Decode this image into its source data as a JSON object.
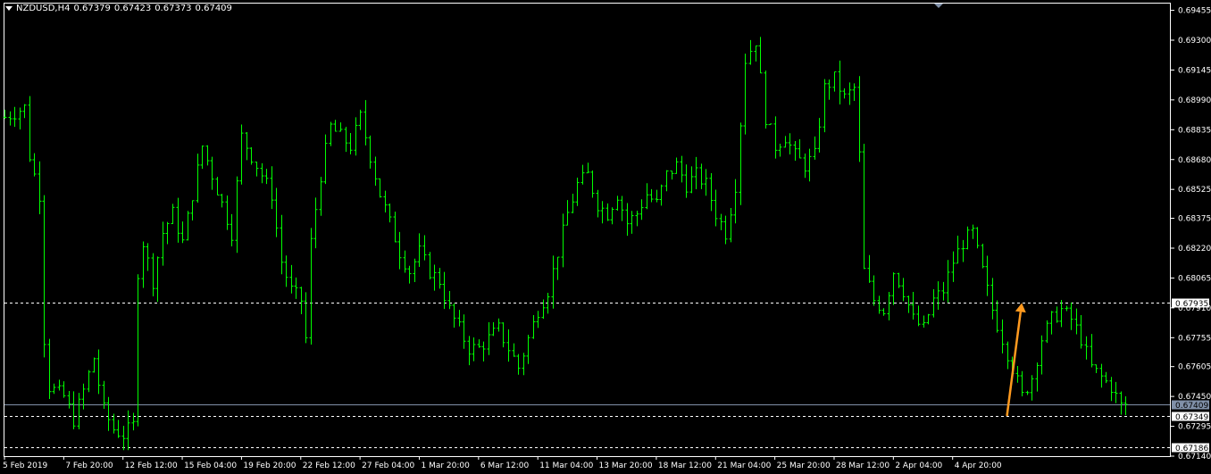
{
  "header": {
    "symbol": "NZDUSD,H4",
    "open": "0.67379",
    "high": "0.67423",
    "low": "0.67373",
    "close": "0.67409"
  },
  "colors": {
    "background": "#000000",
    "candle": "#00ff00",
    "axis": "#ffffff",
    "grid_dashed": "#ffffff",
    "bid_line": "#8090a8",
    "arrow": "#ff9a1f"
  },
  "chart_data": {
    "type": "line",
    "title": "NZDUSD,H4",
    "price_axis_labels": [
      "0.69455",
      "0.69300",
      "0.69145",
      "0.68990",
      "0.68835",
      "0.68680",
      "0.68525",
      "0.68375",
      "0.68220",
      "0.68065",
      "0.67910",
      "0.67755",
      "0.67605",
      "0.67450",
      "0.67295",
      "0.67140"
    ],
    "time_axis_labels": [
      "5 Feb 2019",
      "7 Feb 20:00",
      "12 Feb 12:00",
      "15 Feb 04:00",
      "19 Feb 20:00",
      "22 Feb 12:00",
      "27 Feb 04:00",
      "1 Mar 20:00",
      "6 Mar 12:00",
      "11 Mar 04:00",
      "13 Mar 20:00",
      "18 Mar 12:00",
      "21 Mar 04:00",
      "25 Mar 20:00",
      "28 Mar 12:00",
      "2 Apr 04:00",
      "4 Apr 20:00"
    ],
    "ylim": [
      0.6714,
      0.6949
    ],
    "x_range_bars": [
      0,
      236
    ],
    "x_ticks_bars": [
      0,
      12,
      24,
      36,
      48,
      60,
      72,
      84,
      96,
      108,
      120,
      132,
      144,
      156,
      168,
      180,
      192
    ],
    "horizontal_lines": [
      {
        "price": 0.67935,
        "label": "0.67935",
        "style": "dashed"
      },
      {
        "price": 0.67409,
        "label": "0.67409",
        "style": "solid"
      },
      {
        "price": 0.67349,
        "label": "0.67349",
        "style": "dashed"
      },
      {
        "price": 0.67186,
        "label": "0.67186",
        "style": "dashed"
      }
    ],
    "arrow": {
      "from": {
        "bar": 203,
        "price": 0.67349
      },
      "to": {
        "bar": 206,
        "price": 0.67935
      }
    },
    "series": [
      {
        "price_path": [
          {
            "bar": 0,
            "price": 0.689
          },
          {
            "bar": 4,
            "price": 0.6895
          },
          {
            "bar": 5,
            "price": 0.687
          },
          {
            "bar": 7,
            "price": 0.685
          },
          {
            "bar": 8,
            "price": 0.6775
          },
          {
            "bar": 9,
            "price": 0.675
          },
          {
            "bar": 12,
            "price": 0.6745
          },
          {
            "bar": 14,
            "price": 0.6733
          },
          {
            "bar": 16,
            "price": 0.6748
          },
          {
            "bar": 18,
            "price": 0.6765
          },
          {
            "bar": 20,
            "price": 0.6738
          },
          {
            "bar": 22,
            "price": 0.6728
          },
          {
            "bar": 24,
            "price": 0.6725
          },
          {
            "bar": 26,
            "price": 0.673
          },
          {
            "bar": 27,
            "price": 0.681
          },
          {
            "bar": 28,
            "price": 0.6825
          },
          {
            "bar": 30,
            "price": 0.6805
          },
          {
            "bar": 32,
            "price": 0.683
          },
          {
            "bar": 34,
            "price": 0.684
          },
          {
            "bar": 36,
            "price": 0.6825
          },
          {
            "bar": 38,
            "price": 0.685
          },
          {
            "bar": 40,
            "price": 0.6875
          },
          {
            "bar": 42,
            "price": 0.686
          },
          {
            "bar": 44,
            "price": 0.6845
          },
          {
            "bar": 46,
            "price": 0.683
          },
          {
            "bar": 48,
            "price": 0.688
          },
          {
            "bar": 50,
            "price": 0.687
          },
          {
            "bar": 52,
            "price": 0.686
          },
          {
            "bar": 54,
            "price": 0.685
          },
          {
            "bar": 56,
            "price": 0.6815
          },
          {
            "bar": 58,
            "price": 0.68
          },
          {
            "bar": 60,
            "price": 0.6795
          },
          {
            "bar": 61,
            "price": 0.6775
          },
          {
            "bar": 62,
            "price": 0.6825
          },
          {
            "bar": 64,
            "price": 0.686
          },
          {
            "bar": 66,
            "price": 0.6885
          },
          {
            "bar": 68,
            "price": 0.688
          },
          {
            "bar": 70,
            "price": 0.6875
          },
          {
            "bar": 72,
            "price": 0.689
          },
          {
            "bar": 74,
            "price": 0.687
          },
          {
            "bar": 76,
            "price": 0.685
          },
          {
            "bar": 78,
            "price": 0.6835
          },
          {
            "bar": 80,
            "price": 0.682
          },
          {
            "bar": 82,
            "price": 0.681
          },
          {
            "bar": 84,
            "price": 0.682
          },
          {
            "bar": 86,
            "price": 0.681
          },
          {
            "bar": 88,
            "price": 0.6805
          },
          {
            "bar": 90,
            "price": 0.679
          },
          {
            "bar": 92,
            "price": 0.678
          },
          {
            "bar": 94,
            "price": 0.677
          },
          {
            "bar": 96,
            "price": 0.677
          },
          {
            "bar": 98,
            "price": 0.6775
          },
          {
            "bar": 100,
            "price": 0.678
          },
          {
            "bar": 102,
            "price": 0.677
          },
          {
            "bar": 104,
            "price": 0.676
          },
          {
            "bar": 106,
            "price": 0.6775
          },
          {
            "bar": 108,
            "price": 0.679
          },
          {
            "bar": 110,
            "price": 0.68
          },
          {
            "bar": 112,
            "price": 0.682
          },
          {
            "bar": 114,
            "price": 0.684
          },
          {
            "bar": 116,
            "price": 0.6855
          },
          {
            "bar": 118,
            "price": 0.686
          },
          {
            "bar": 120,
            "price": 0.6845
          },
          {
            "bar": 122,
            "price": 0.684
          },
          {
            "bar": 124,
            "price": 0.685
          },
          {
            "bar": 126,
            "price": 0.6835
          },
          {
            "bar": 128,
            "price": 0.684
          },
          {
            "bar": 130,
            "price": 0.685
          },
          {
            "bar": 132,
            "price": 0.6845
          },
          {
            "bar": 134,
            "price": 0.686
          },
          {
            "bar": 136,
            "price": 0.6865
          },
          {
            "bar": 138,
            "price": 0.6855
          },
          {
            "bar": 140,
            "price": 0.686
          },
          {
            "bar": 142,
            "price": 0.6855
          },
          {
            "bar": 144,
            "price": 0.684
          },
          {
            "bar": 146,
            "price": 0.683
          },
          {
            "bar": 148,
            "price": 0.6855
          },
          {
            "bar": 150,
            "price": 0.692
          },
          {
            "bar": 152,
            "price": 0.693
          },
          {
            "bar": 154,
            "price": 0.689
          },
          {
            "bar": 156,
            "price": 0.6875
          },
          {
            "bar": 158,
            "price": 0.688
          },
          {
            "bar": 160,
            "price": 0.687
          },
          {
            "bar": 162,
            "price": 0.6865
          },
          {
            "bar": 164,
            "price": 0.687
          },
          {
            "bar": 166,
            "price": 0.6905
          },
          {
            "bar": 168,
            "price": 0.691
          },
          {
            "bar": 170,
            "price": 0.69
          },
          {
            "bar": 172,
            "price": 0.6905
          },
          {
            "bar": 173,
            "price": 0.687
          },
          {
            "bar": 174,
            "price": 0.681
          },
          {
            "bar": 176,
            "price": 0.6795
          },
          {
            "bar": 178,
            "price": 0.679
          },
          {
            "bar": 180,
            "price": 0.681
          },
          {
            "bar": 182,
            "price": 0.68
          },
          {
            "bar": 184,
            "price": 0.6785
          },
          {
            "bar": 186,
            "price": 0.678
          },
          {
            "bar": 188,
            "price": 0.6795
          },
          {
            "bar": 190,
            "price": 0.68
          },
          {
            "bar": 192,
            "price": 0.6815
          },
          {
            "bar": 194,
            "price": 0.6825
          },
          {
            "bar": 196,
            "price": 0.683
          },
          {
            "bar": 198,
            "price": 0.681
          },
          {
            "bar": 200,
            "price": 0.679
          },
          {
            "bar": 202,
            "price": 0.6775
          },
          {
            "bar": 204,
            "price": 0.676
          },
          {
            "bar": 206,
            "price": 0.6745
          },
          {
            "bar": 208,
            "price": 0.6755
          },
          {
            "bar": 210,
            "price": 0.6775
          },
          {
            "bar": 212,
            "price": 0.6785
          },
          {
            "bar": 214,
            "price": 0.679
          },
          {
            "bar": 216,
            "price": 0.6785
          },
          {
            "bar": 218,
            "price": 0.6775
          },
          {
            "bar": 220,
            "price": 0.676
          },
          {
            "bar": 222,
            "price": 0.6755
          },
          {
            "bar": 224,
            "price": 0.675
          },
          {
            "bar": 226,
            "price": 0.674
          },
          {
            "bar": 227,
            "price": 0.67409
          }
        ]
      }
    ]
  }
}
